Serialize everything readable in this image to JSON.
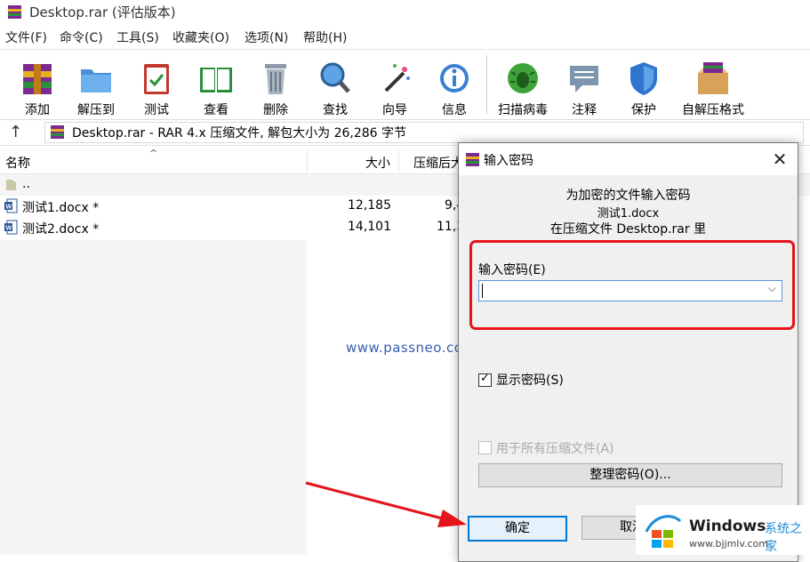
{
  "window": {
    "title": "Desktop.rar (评估版本)"
  },
  "menu": [
    "文件(F)",
    "命令(C)",
    "工具(S)",
    "收藏夹(O)",
    "选项(N)",
    "帮助(H)"
  ],
  "toolbar": {
    "add": "添加",
    "extract": "解压到",
    "test": "测试",
    "view": "查看",
    "delete": "删除",
    "find": "查找",
    "wizard": "向导",
    "info": "信息",
    "virus": "扫描病毒",
    "comment": "注释",
    "protect": "保护",
    "sfx": "自解压格式"
  },
  "pathbar": {
    "text": "Desktop.rar - RAR 4.x 压缩文件, 解包大小为 26,286 字节"
  },
  "list": {
    "columns": {
      "name": "名称",
      "size": "大小",
      "packed": "压缩后大"
    },
    "rows": [
      {
        "name": "..",
        "size": "",
        "packed": ""
      },
      {
        "name": "测试1.docx *",
        "size": "12,185",
        "packed": "9,4"
      },
      {
        "name": "测试2.docx *",
        "size": "14,101",
        "packed": "11,3"
      }
    ]
  },
  "watermark": "www.passneo.com",
  "dialog": {
    "title": "输入密码",
    "line1": "为加密的文件输入密码",
    "line2": "测试1.docx",
    "line3": "在压缩文件 Desktop.rar 里",
    "password_label": "输入密码(E)",
    "password_value": "",
    "show_password_label": "显示密码(S)",
    "show_password_checked": true,
    "use_for_all_label": "用于所有压缩文件(A)",
    "use_for_all_checked": false,
    "manage_label": "整理密码(O)...",
    "ok_label": "确定",
    "cancel_label": "取消"
  },
  "logo": {
    "brand": "Windows",
    "brand_cn": "系统之家",
    "url": "www.bjjmlv.com"
  },
  "colors": {
    "highlight_box": "#e4141b",
    "watermark": "#3a5db0",
    "ok_border": "#0078d7"
  }
}
